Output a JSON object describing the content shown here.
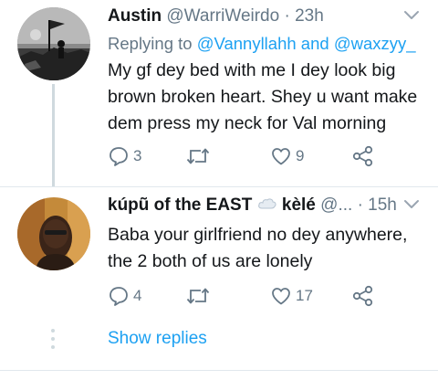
{
  "tweets": [
    {
      "name": "Austin",
      "handle": "@WarriWeirdo",
      "separator": "·",
      "time": "23h",
      "replying_prefix": "Replying to",
      "replying_user_1": "@Vannyllahh",
      "replying_and": "and",
      "replying_user_2": "@waxzyy_",
      "text": "My gf dey bed with me I dey look big brown broken heart. Shey u want make dem press my neck for Val morning",
      "reply_count": "3",
      "retweet_count": "",
      "like_count": "9"
    },
    {
      "name": "kúpũ of the EAST",
      "emoji_name": "kèlé",
      "handle": "@...",
      "separator": "·",
      "time": "15h",
      "text": "Baba your girlfriend no dey anywhere, the 2 both of us are lonely",
      "reply_count": "4",
      "retweet_count": "",
      "like_count": "17"
    }
  ],
  "show_replies": "Show replies",
  "icons": {
    "reply": "reply-icon",
    "retweet": "retweet-icon",
    "like": "heart-icon",
    "share": "share-icon",
    "caret": "chevron-down-icon",
    "emoji": "cloud-emoji-icon"
  },
  "colors": {
    "link": "#1da1f2",
    "muted": "#657786",
    "text": "#14171a",
    "line": "#cfd9de"
  }
}
